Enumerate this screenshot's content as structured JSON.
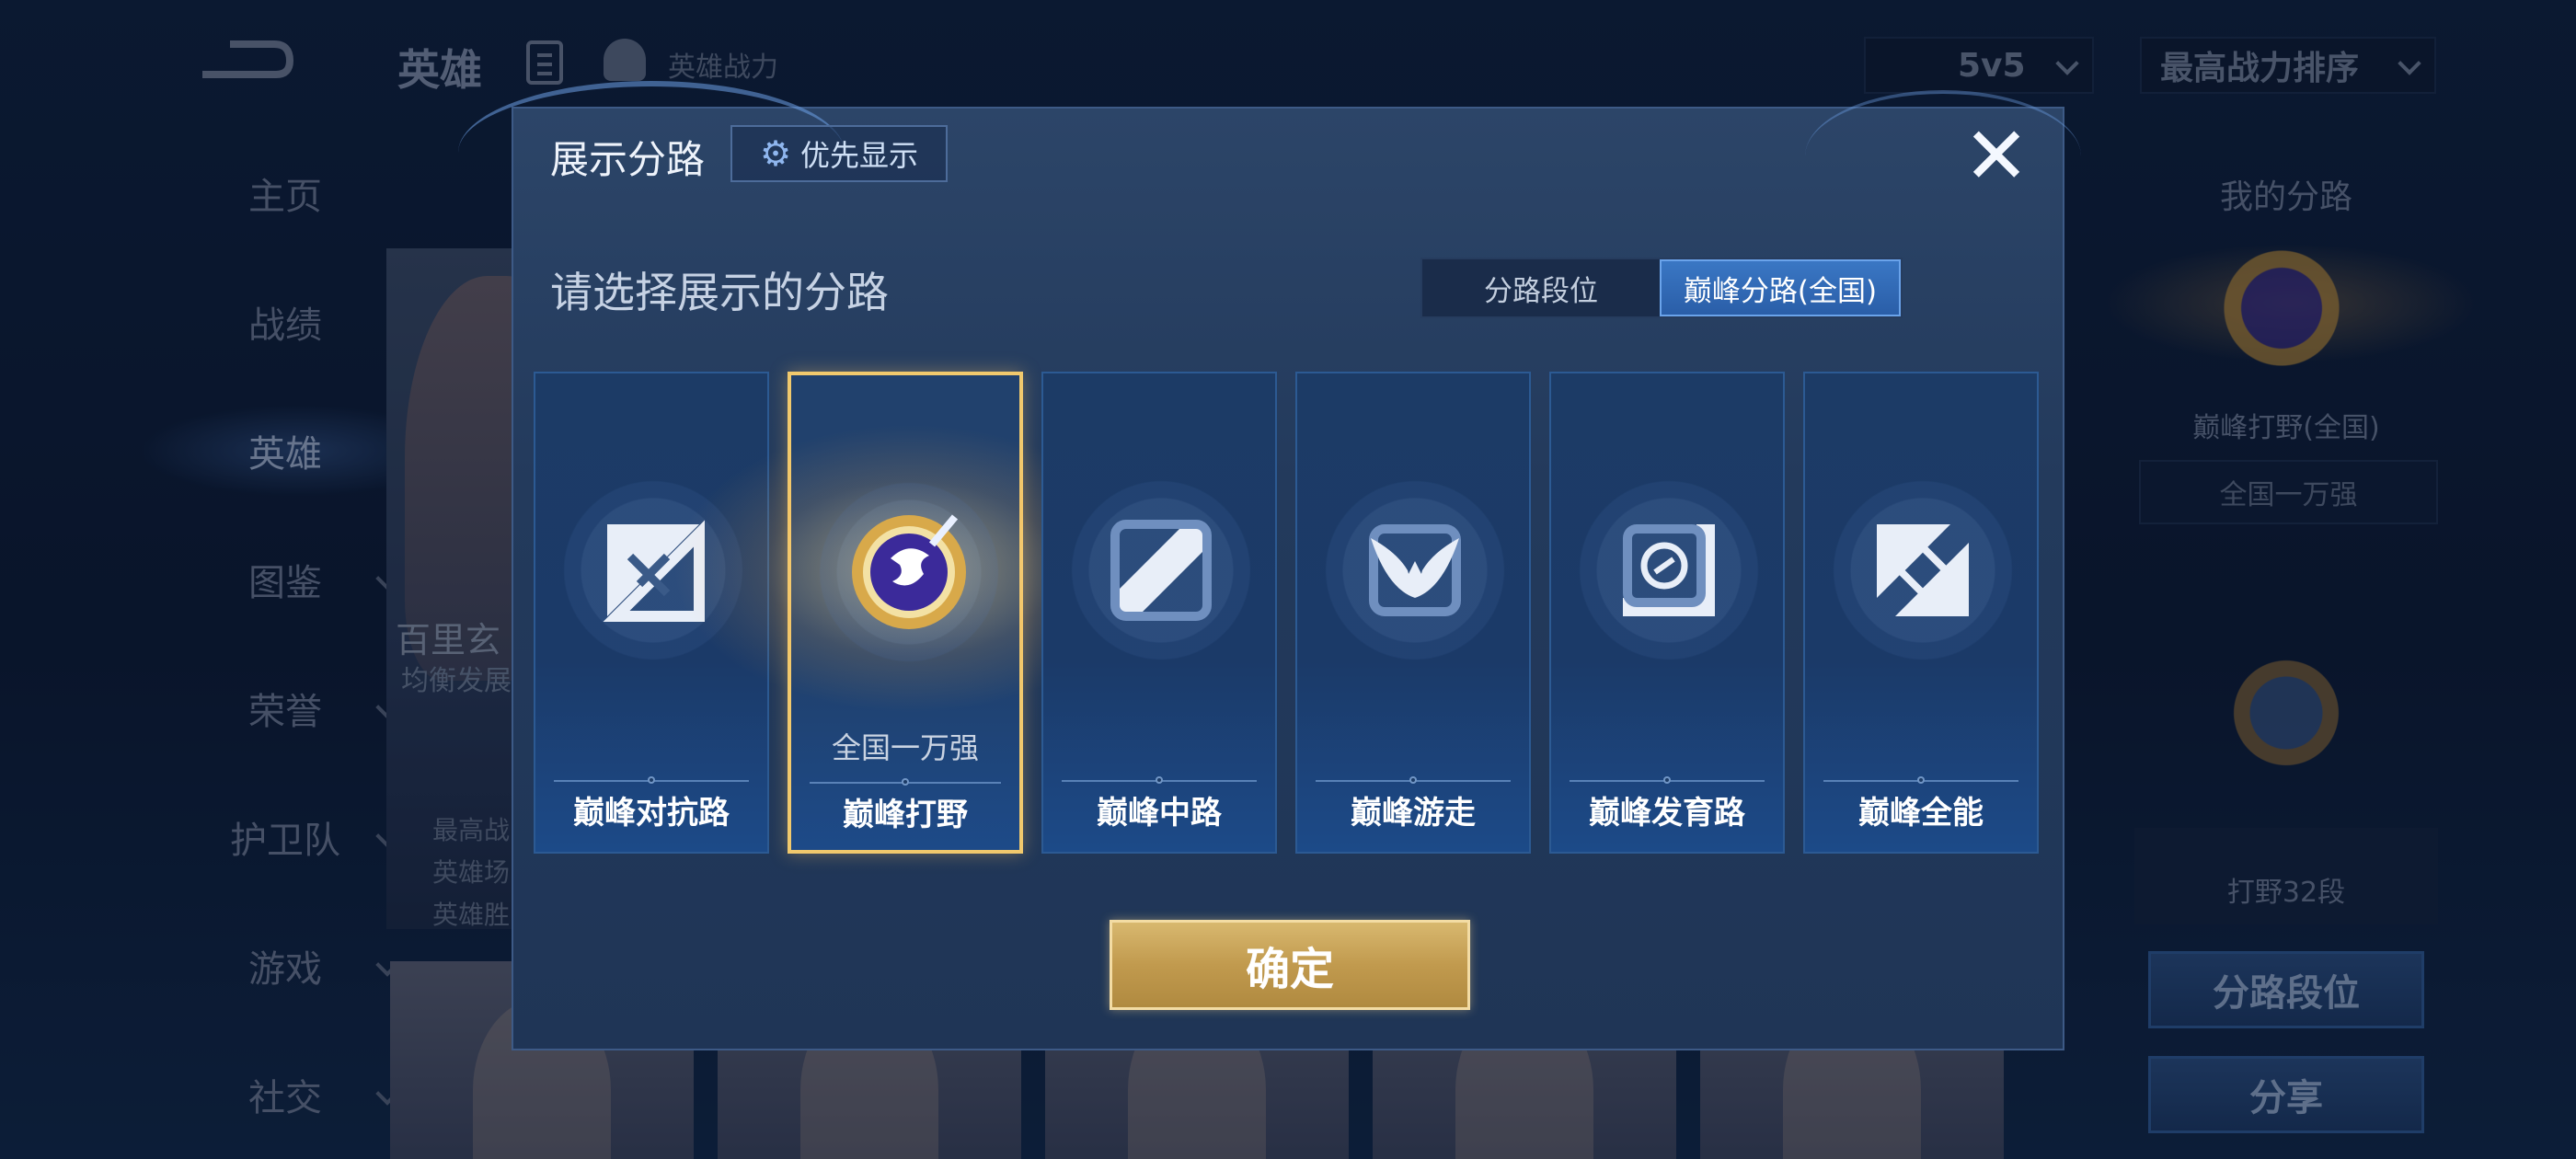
{
  "background": {
    "header": {
      "title": "英雄",
      "power_label": "英雄战力"
    },
    "mode_select": "5v5",
    "sort_select": "最高战力排序",
    "nav": [
      {
        "label": "主页"
      },
      {
        "label": "战绩"
      },
      {
        "label": "英雄"
      },
      {
        "label": "图鉴"
      },
      {
        "label": "荣誉"
      },
      {
        "label": "护卫队"
      },
      {
        "label": "游戏"
      },
      {
        "label": "社交"
      }
    ],
    "hero_card": {
      "name": "百里玄",
      "type": "均衡发展",
      "lines": [
        "最高战",
        "英雄场",
        "英雄胜"
      ]
    },
    "right_panel": {
      "title": "我的分路",
      "lane_name": "巅峰打野(全国)",
      "rank": "全国一万强",
      "rank_level": "打野32段",
      "lane_rank_button": "分路段位",
      "share_button": "分享"
    }
  },
  "modal": {
    "title": "展示分路",
    "priority_button": "优先显示",
    "subtitle": "请选择展示的分路",
    "tabs": [
      {
        "label": "分路段位",
        "active": false
      },
      {
        "label": "巅峰分路(全国)",
        "active": true
      }
    ],
    "lanes": [
      {
        "label": "巅峰对抗路",
        "rank": "",
        "selected": false,
        "icon": "sword-lane-icon"
      },
      {
        "label": "巅峰打野",
        "rank": "全国一万强",
        "selected": true,
        "icon": "jungle-emblem-icon"
      },
      {
        "label": "巅峰中路",
        "rank": "",
        "selected": false,
        "icon": "mid-lane-icon"
      },
      {
        "label": "巅峰游走",
        "rank": "",
        "selected": false,
        "icon": "roam-wings-icon"
      },
      {
        "label": "巅峰发育路",
        "rank": "",
        "selected": false,
        "icon": "farm-lane-icon"
      },
      {
        "label": "巅峰全能",
        "rank": "",
        "selected": false,
        "icon": "all-round-icon"
      }
    ],
    "confirm_button": "确定"
  }
}
